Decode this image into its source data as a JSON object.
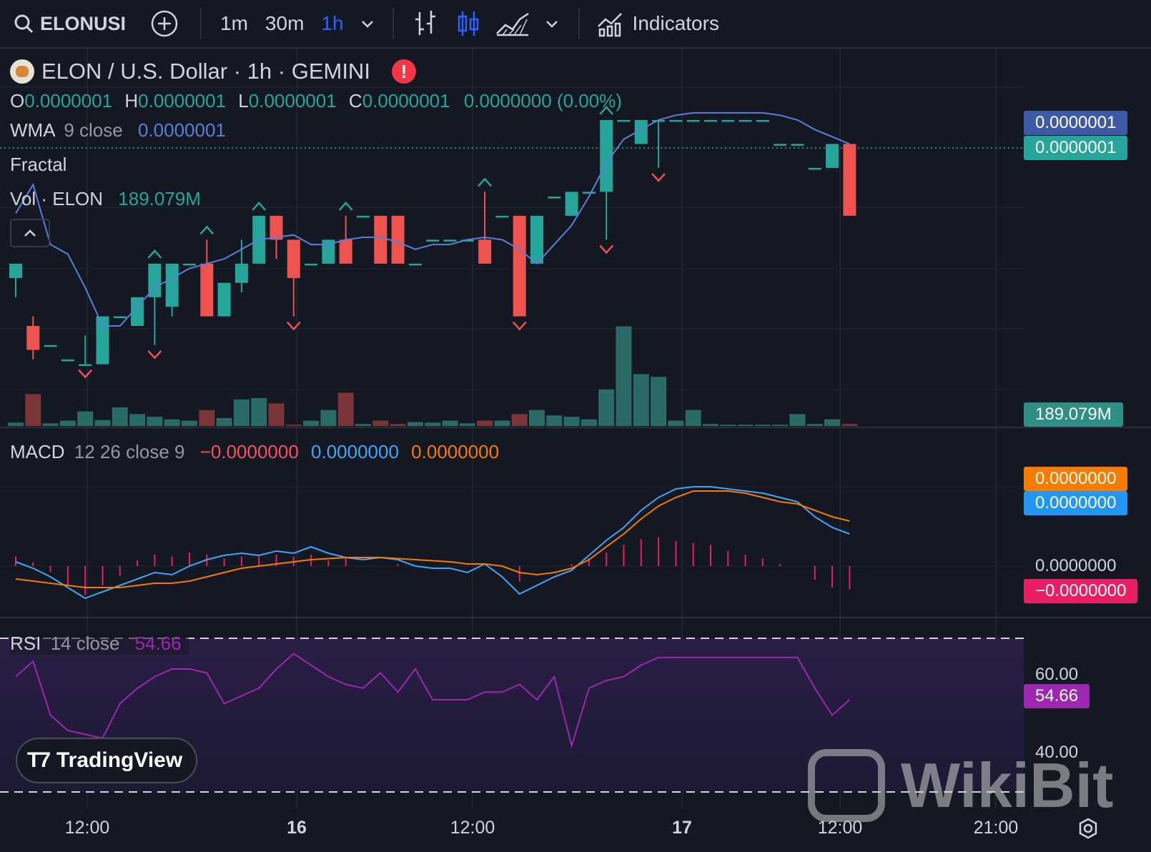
{
  "toolbar": {
    "symbol": "ELONUSI",
    "timeframes": [
      "1m",
      "30m",
      "1h"
    ],
    "active_timeframe": "1h",
    "indicators_label": "Indicators"
  },
  "legend": {
    "title": "ELON / U.S. Dollar · 1h · GEMINI",
    "ohlc": {
      "o_label": "O",
      "o": "0.0000001",
      "h_label": "H",
      "h": "0.0000001",
      "l_label": "L",
      "l": "0.0000001",
      "c_label": "C",
      "c": "0.0000001",
      "change": "0.0000000 (0.00%)"
    },
    "wma": {
      "label": "WMA",
      "params": "9 close",
      "value": "0.0000001"
    },
    "fractal": {
      "label": "Fractal"
    },
    "vol": {
      "label": "Vol · ELON",
      "value": "189.079M"
    }
  },
  "price_axis": {
    "wma_tag": "0.0000001",
    "last_price_tag": "0.0000001",
    "volume_tag": "189.079M"
  },
  "macd": {
    "label": "MACD",
    "params": "12 26 close 9",
    "hist": "−0.0000000",
    "macd": "0.0000000",
    "signal": "0.0000000",
    "axis": {
      "signal_tag": "0.0000000",
      "macd_tag": "0.0000000",
      "zero": "0.0000000",
      "hist_tag": "−0.0000000"
    }
  },
  "rsi": {
    "label": "RSI",
    "params": "14 close",
    "value": "54.66",
    "axis": {
      "upper": "60.00",
      "lower": "40.00",
      "value_tag": "54.66"
    }
  },
  "time_axis": [
    "12:00",
    "16",
    "12:00",
    "17",
    "12:00",
    "21:00"
  ],
  "branding": {
    "tradingview": "TradingView",
    "watermark": "WikiBit"
  },
  "colors": {
    "up": "#26a69a",
    "down": "#ef5350",
    "wma": "#5b7fd6",
    "macd": "#42a5f5",
    "signal": "#f57c00",
    "rsi": "#9c27b0",
    "bg": "#141823"
  },
  "chart_data": {
    "type": "candlestick",
    "x": [
      0,
      1,
      2,
      3,
      4,
      5,
      6,
      7,
      8,
      9,
      10,
      11,
      12,
      13,
      14,
      15,
      16,
      17,
      18,
      19,
      20,
      21,
      22,
      23,
      24,
      25,
      26,
      27,
      28,
      29,
      30,
      31,
      32,
      33,
      34,
      35,
      36,
      37,
      38,
      39,
      40,
      41,
      42,
      43,
      44,
      45,
      46,
      47,
      48
    ],
    "ohlc_note": "values in chart price units (axis shows 0.0000001 precision)",
    "candles": [
      {
        "o": 3.0,
        "h": 3.2,
        "l": 2.6,
        "c": 3.3
      },
      {
        "o": 2.0,
        "h": 2.2,
        "l": 1.3,
        "c": 1.5
      },
      {
        "o": 1.6,
        "h": 1.6,
        "l": 1.6,
        "c": 1.6
      },
      {
        "o": 1.3,
        "h": 1.3,
        "l": 1.3,
        "c": 1.3
      },
      {
        "o": 1.2,
        "h": 1.8,
        "l": 1.2,
        "c": 1.2
      },
      {
        "o": 1.2,
        "h": 2.0,
        "l": 1.2,
        "c": 2.2
      },
      {
        "o": 2.2,
        "h": 2.2,
        "l": 2.2,
        "c": 2.2
      },
      {
        "o": 2.0,
        "h": 2.0,
        "l": 2.0,
        "c": 2.6
      },
      {
        "o": 2.6,
        "h": 3.3,
        "l": 1.6,
        "c": 3.3
      },
      {
        "o": 2.4,
        "h": 3.3,
        "l": 2.2,
        "c": 3.3
      },
      {
        "o": 3.3,
        "h": 3.3,
        "l": 3.3,
        "c": 3.3
      },
      {
        "o": 3.3,
        "h": 3.8,
        "l": 2.2,
        "c": 2.2
      },
      {
        "o": 2.2,
        "h": 2.2,
        "l": 2.2,
        "c": 2.9
      },
      {
        "o": 2.9,
        "h": 3.8,
        "l": 2.7,
        "c": 3.3
      },
      {
        "o": 3.3,
        "h": 4.3,
        "l": 3.3,
        "c": 4.3
      },
      {
        "o": 4.3,
        "h": 4.3,
        "l": 3.4,
        "c": 3.8
      },
      {
        "o": 3.8,
        "h": 3.8,
        "l": 2.2,
        "c": 3.0
      },
      {
        "o": 3.3,
        "h": 3.3,
        "l": 3.3,
        "c": 3.3
      },
      {
        "o": 3.3,
        "h": 3.8,
        "l": 3.3,
        "c": 3.8
      },
      {
        "o": 3.8,
        "h": 4.3,
        "l": 3.3,
        "c": 3.3
      },
      {
        "o": 4.3,
        "h": 4.3,
        "l": 4.3,
        "c": 4.3
      },
      {
        "o": 4.3,
        "h": 4.3,
        "l": 3.3,
        "c": 3.3
      },
      {
        "o": 4.3,
        "h": 4.3,
        "l": 3.3,
        "c": 3.3
      },
      {
        "o": 3.3,
        "h": 3.3,
        "l": 3.3,
        "c": 3.3
      },
      {
        "o": 3.8,
        "h": 3.8,
        "l": 3.8,
        "c": 3.8
      },
      {
        "o": 3.8,
        "h": 3.8,
        "l": 3.8,
        "c": 3.8
      },
      {
        "o": 3.8,
        "h": 3.8,
        "l": 3.8,
        "c": 3.8
      },
      {
        "o": 3.8,
        "h": 4.8,
        "l": 3.3,
        "c": 3.3
      },
      {
        "o": 4.3,
        "h": 4.3,
        "l": 4.3,
        "c": 4.3
      },
      {
        "o": 4.3,
        "h": 4.3,
        "l": 2.2,
        "c": 2.2
      },
      {
        "o": 3.3,
        "h": 4.3,
        "l": 3.3,
        "c": 4.3
      },
      {
        "o": 4.7,
        "h": 4.7,
        "l": 4.7,
        "c": 4.7
      },
      {
        "o": 4.3,
        "h": 4.8,
        "l": 4.3,
        "c": 4.8
      },
      {
        "o": 4.8,
        "h": 4.8,
        "l": 4.8,
        "c": 4.8
      },
      {
        "o": 4.8,
        "h": 6.3,
        "l": 3.8,
        "c": 6.3
      },
      {
        "o": 6.3,
        "h": 6.3,
        "l": 6.3,
        "c": 6.3
      },
      {
        "o": 5.8,
        "h": 6.3,
        "l": 5.8,
        "c": 6.3
      },
      {
        "o": 6.3,
        "h": 6.3,
        "l": 5.3,
        "c": 6.3
      },
      {
        "o": 6.3,
        "h": 6.3,
        "l": 6.3,
        "c": 6.3
      },
      {
        "o": 6.3,
        "h": 6.3,
        "l": 6.3,
        "c": 6.3
      },
      {
        "o": 6.3,
        "h": 6.3,
        "l": 6.3,
        "c": 6.3
      },
      {
        "o": 6.3,
        "h": 6.3,
        "l": 6.3,
        "c": 6.3
      },
      {
        "o": 6.3,
        "h": 6.3,
        "l": 6.3,
        "c": 6.3
      },
      {
        "o": 6.3,
        "h": 6.3,
        "l": 6.3,
        "c": 6.3
      },
      {
        "o": 5.8,
        "h": 5.8,
        "l": 5.8,
        "c": 5.8
      },
      {
        "o": 5.8,
        "h": 5.8,
        "l": 5.8,
        "c": 5.8
      },
      {
        "o": 5.3,
        "h": 5.3,
        "l": 5.3,
        "c": 5.3
      },
      {
        "o": 5.3,
        "h": 5.8,
        "l": 5.3,
        "c": 5.8
      },
      {
        "o": 5.8,
        "h": 5.8,
        "l": 4.3,
        "c": 4.3
      }
    ],
    "volume": [
      5,
      48,
      4,
      8,
      22,
      9,
      28,
      18,
      14,
      10,
      8,
      24,
      12,
      40,
      42,
      34,
      2,
      8,
      24,
      50,
      3,
      8,
      3,
      6,
      5,
      8,
      4,
      8,
      8,
      18,
      24,
      16,
      14,
      10,
      55,
      150,
      78,
      74,
      8,
      24,
      3,
      2,
      2,
      2,
      2,
      18,
      3,
      10,
      3
    ],
    "wma": [
      4.35,
      4.95,
      3.7,
      3.5,
      2.8,
      2.0,
      2.0,
      2.4,
      2.8,
      3.0,
      3.2,
      3.3,
      3.4,
      3.6,
      3.8,
      3.85,
      3.9,
      3.7,
      3.7,
      3.8,
      3.85,
      3.85,
      3.75,
      3.6,
      3.7,
      3.7,
      3.8,
      3.85,
      3.8,
      3.6,
      3.3,
      3.7,
      4.1,
      4.7,
      5.4,
      5.9,
      6.1,
      6.3,
      6.4,
      6.45,
      6.45,
      6.45,
      6.45,
      6.45,
      6.4,
      6.3,
      6.1,
      5.95,
      5.8
    ],
    "macd_line": [
      0.2,
      -0.1,
      -0.5,
      -1.0,
      -1.5,
      -1.2,
      -0.9,
      -0.6,
      -0.3,
      -0.4,
      0.0,
      0.3,
      0.5,
      0.6,
      0.5,
      0.7,
      0.6,
      0.9,
      0.6,
      0.4,
      0.3,
      0.4,
      0.3,
      0.0,
      -0.1,
      -0.1,
      -0.3,
      0.1,
      -0.5,
      -1.3,
      -0.9,
      -0.5,
      -0.2,
      0.5,
      1.2,
      1.8,
      2.6,
      3.2,
      3.6,
      3.7,
      3.7,
      3.6,
      3.5,
      3.4,
      3.2,
      3.0,
      2.3,
      1.8,
      1.5
    ],
    "signal_line": [
      -0.6,
      -0.7,
      -0.8,
      -0.9,
      -1.0,
      -1.0,
      -1.0,
      -0.9,
      -0.8,
      -0.8,
      -0.7,
      -0.5,
      -0.3,
      -0.1,
      0.0,
      0.1,
      0.2,
      0.3,
      0.35,
      0.4,
      0.4,
      0.4,
      0.35,
      0.3,
      0.25,
      0.2,
      0.1,
      0.1,
      0.0,
      -0.3,
      -0.4,
      -0.3,
      -0.1,
      0.3,
      0.9,
      1.5,
      2.2,
      2.8,
      3.2,
      3.5,
      3.5,
      3.5,
      3.4,
      3.2,
      3.0,
      2.9,
      2.6,
      2.3,
      2.1
    ],
    "macd_hist": [
      0.5,
      0.2,
      -0.3,
      -1.0,
      -1.5,
      -1.0,
      -0.5,
      0.3,
      0.6,
      0.5,
      0.7,
      0.6,
      0.4,
      0.5,
      0.5,
      0.6,
      0.5,
      0.6,
      0.3,
      0.4,
      0.0,
      0.0,
      0.1,
      0.0,
      0.0,
      0.0,
      0.0,
      0.0,
      0.0,
      -0.8,
      0.0,
      0.0,
      0.1,
      0.4,
      0.7,
      1.1,
      1.4,
      1.5,
      1.3,
      1.2,
      1.1,
      0.8,
      0.6,
      0.4,
      0.1,
      0.0,
      -0.7,
      -1.1,
      -1.2
    ],
    "rsi": [
      60,
      64,
      50,
      46,
      45,
      44,
      53,
      57,
      60,
      62,
      62,
      61,
      53,
      55,
      57,
      62,
      66,
      63,
      60,
      58,
      57,
      61,
      56,
      62,
      54,
      54,
      54,
      56,
      56,
      58,
      54,
      60,
      42,
      57,
      59,
      60,
      63,
      65,
      65,
      65,
      65,
      65,
      65,
      65,
      65,
      65,
      57,
      50,
      54
    ],
    "rsi_bands": [
      70,
      30
    ],
    "rsi_levels": [
      60,
      40
    ]
  }
}
